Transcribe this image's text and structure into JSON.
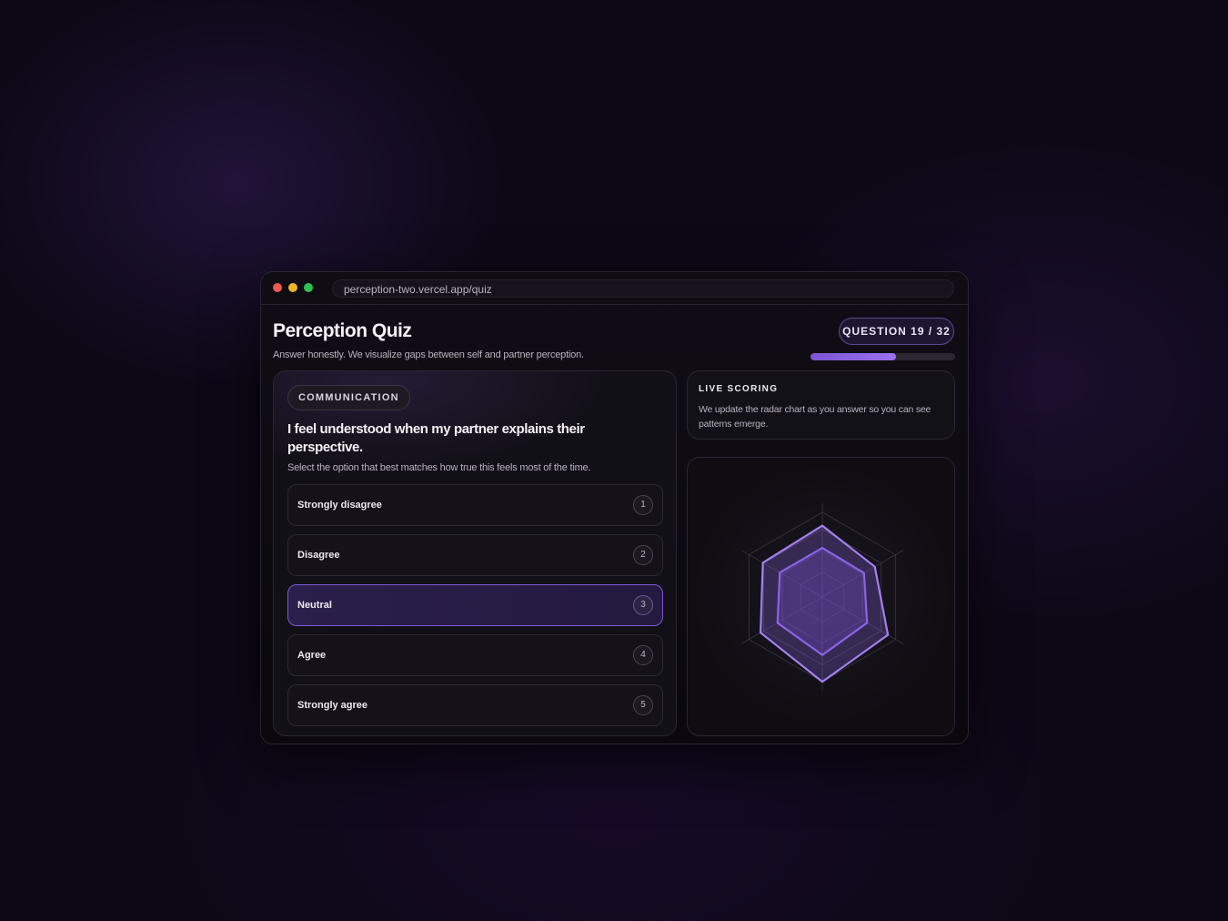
{
  "browser": {
    "url": "perception-two.vercel.app/quiz"
  },
  "header": {
    "title": "Perception Quiz",
    "subtitle": "Answer honestly. We visualize gaps between self and partner perception.",
    "question_badge": "QUESTION 19 / 32",
    "progress": 0.59
  },
  "question_card": {
    "category": "COMMUNICATION",
    "question": "I feel understood when my partner explains their perspective.",
    "instruction": "Select the option that best matches how true this feels most of the time.",
    "selected": 3,
    "options": [
      {
        "label": "Strongly disagree",
        "num": "1"
      },
      {
        "label": "Disagree",
        "num": "2"
      },
      {
        "label": "Neutral",
        "num": "3"
      },
      {
        "label": "Agree",
        "num": "4"
      },
      {
        "label": "Strongly agree",
        "num": "5"
      }
    ]
  },
  "live_scoring": {
    "title": "LIVE SCORING",
    "text": "We update the radar chart as you answer so you can see patterns emerge."
  },
  "colors": {
    "accent": "#8b63e6",
    "background": "#0d0816",
    "panel": "#121017"
  },
  "chart_data": {
    "type": "radar",
    "axes": 6,
    "max": 1.0,
    "series": [
      {
        "values": [
          0.8,
          0.68,
          0.85,
          0.95,
          0.8,
          0.77
        ],
        "color": "#a280f0"
      },
      {
        "values": [
          0.55,
          0.54,
          0.58,
          0.65,
          0.58,
          0.55
        ],
        "color": "#8b63e6"
      }
    ]
  }
}
